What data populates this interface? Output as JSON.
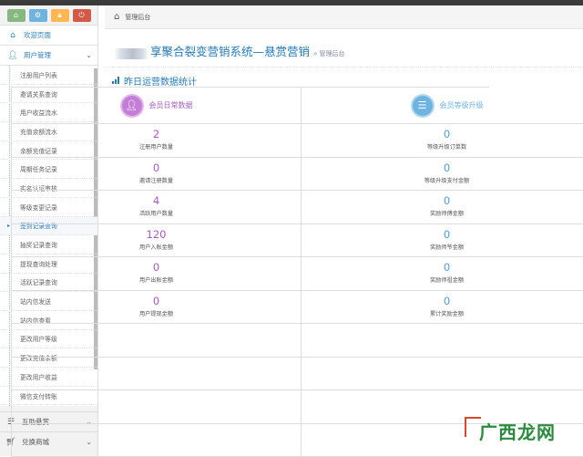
{
  "shortcuts": [
    {
      "icon": "home-icon",
      "color": "#87b87f"
    },
    {
      "icon": "gear-icon",
      "color": "#6fb3e0"
    },
    {
      "icon": "lock-icon",
      "color": "#ffb752"
    },
    {
      "icon": "power-icon",
      "color": "#d15b47"
    }
  ],
  "sidebar": {
    "welcome": "欢迎页面",
    "user_mgmt": "用户管理",
    "items": [
      "注册用户列表",
      "邀请关系查询",
      "用户收益流水",
      "充值余额流水",
      "余额充值记录",
      "周期任务记录",
      "实名认证审核",
      "等级变更记录",
      "签到记录查询",
      "抽奖记录查询",
      "提现查询处理",
      "活跃记录查询",
      "站内信发送",
      "站内信查看",
      "更改用户等级",
      "更改充值余额",
      "更改用户收益",
      "微信支付转账"
    ],
    "active_index": 8,
    "bottom": [
      {
        "label": "互助悬赏",
        "icon": "list-icon"
      },
      {
        "label": "兑换商城",
        "icon": "shopping-icon"
      }
    ]
  },
  "breadcrumb": "管理后台",
  "page": {
    "title": "享聚合裂变营销系统—悬赏营销",
    "subtitle": "» 管理后台"
  },
  "section_title": "昨日运营数据统计",
  "columns": [
    {
      "title": "会员日常数据",
      "icon": "user-icon",
      "stats": [
        {
          "value": "2",
          "label": "注册用户数量"
        },
        {
          "value": "0",
          "label": "邀请注册数量"
        },
        {
          "value": "4",
          "label": "活跃用户数量"
        },
        {
          "value": "120",
          "label": "用户入账金额"
        },
        {
          "value": "0",
          "label": "用户出账金额"
        },
        {
          "value": "0",
          "label": "用户提现金额"
        }
      ]
    },
    {
      "title": "会员等级升级",
      "icon": "menu-icon",
      "stats": [
        {
          "value": "0",
          "label": "等级升级订单数"
        },
        {
          "value": "0",
          "label": "等级升级支付金额"
        },
        {
          "value": "0",
          "label": "奖励师傅金额"
        },
        {
          "value": "0",
          "label": "奖励师爷金额"
        },
        {
          "value": "0",
          "label": "奖励师祖金额"
        },
        {
          "value": "0",
          "label": "累计奖励金额"
        }
      ]
    }
  ],
  "watermark": "广西龙网"
}
